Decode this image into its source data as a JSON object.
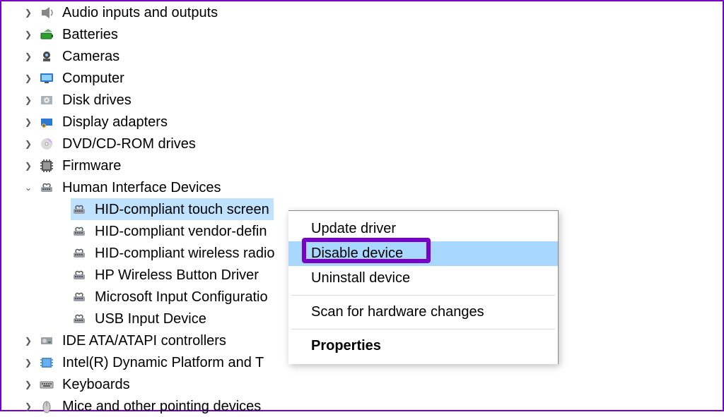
{
  "tree": {
    "audio": "Audio inputs and outputs",
    "batteries": "Batteries",
    "cameras": "Cameras",
    "computer": "Computer",
    "disk": "Disk drives",
    "display": "Display adapters",
    "dvd": "DVD/CD-ROM drives",
    "firmware": "Firmware",
    "hid": "Human Interface Devices",
    "hid_children": {
      "touch": "HID-compliant touch screen",
      "vendor": "HID-compliant vendor-defin",
      "radio": "HID-compliant wireless radio",
      "hpbtn": "HP Wireless Button Driver",
      "msinput": "Microsoft Input Configuratio",
      "usb": "USB Input Device"
    },
    "ide": "IDE ATA/ATAPI controllers",
    "intel": "Intel(R) Dynamic Platform and T",
    "keyboards": "Keyboards",
    "mice": "Mice and other pointing devices"
  },
  "ctx": {
    "update": "Update driver",
    "disable": "Disable device",
    "uninstall": "Uninstall device",
    "scan": "Scan for hardware changes",
    "properties": "Properties"
  }
}
